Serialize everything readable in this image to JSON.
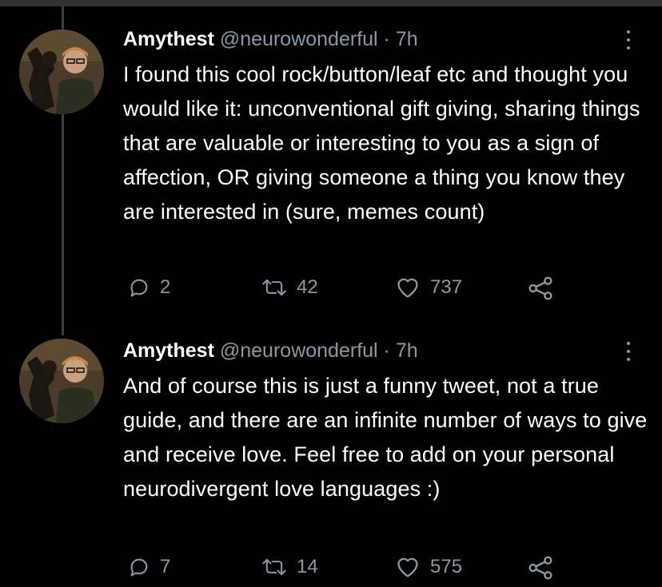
{
  "tweets": [
    {
      "author": "Amythest",
      "handle": "@neurowonderful",
      "separator": "·",
      "time": "7h",
      "text": "I found this cool rock/button/leaf etc and thought you would like it: unconventional gift giving, sharing things that are valuable or interesting to you as a sign of affection, OR giving someone a thing you know they are interested in (sure, memes count)",
      "replies": "2",
      "retweets": "42",
      "likes": "737"
    },
    {
      "author": "Amythest",
      "handle": "@neurowonderful",
      "separator": "·",
      "time": "7h",
      "text": "And of course this is just a funny tweet, not a true guide, and there are an infinite number of ways to give and receive love. Feel free to add on your personal neurodivergent love languages :)",
      "replies": "7",
      "retweets": "14",
      "likes": "575"
    }
  ],
  "icons": {
    "reply": "reply-icon",
    "retweet": "retweet-icon",
    "like": "heart-icon",
    "share": "share-icon",
    "more": "more-vertical-icon"
  },
  "colors": {
    "background": "#000000",
    "text": "#ffffff",
    "secondary": "#8b98a5",
    "thread_line": "#3a3f44"
  }
}
